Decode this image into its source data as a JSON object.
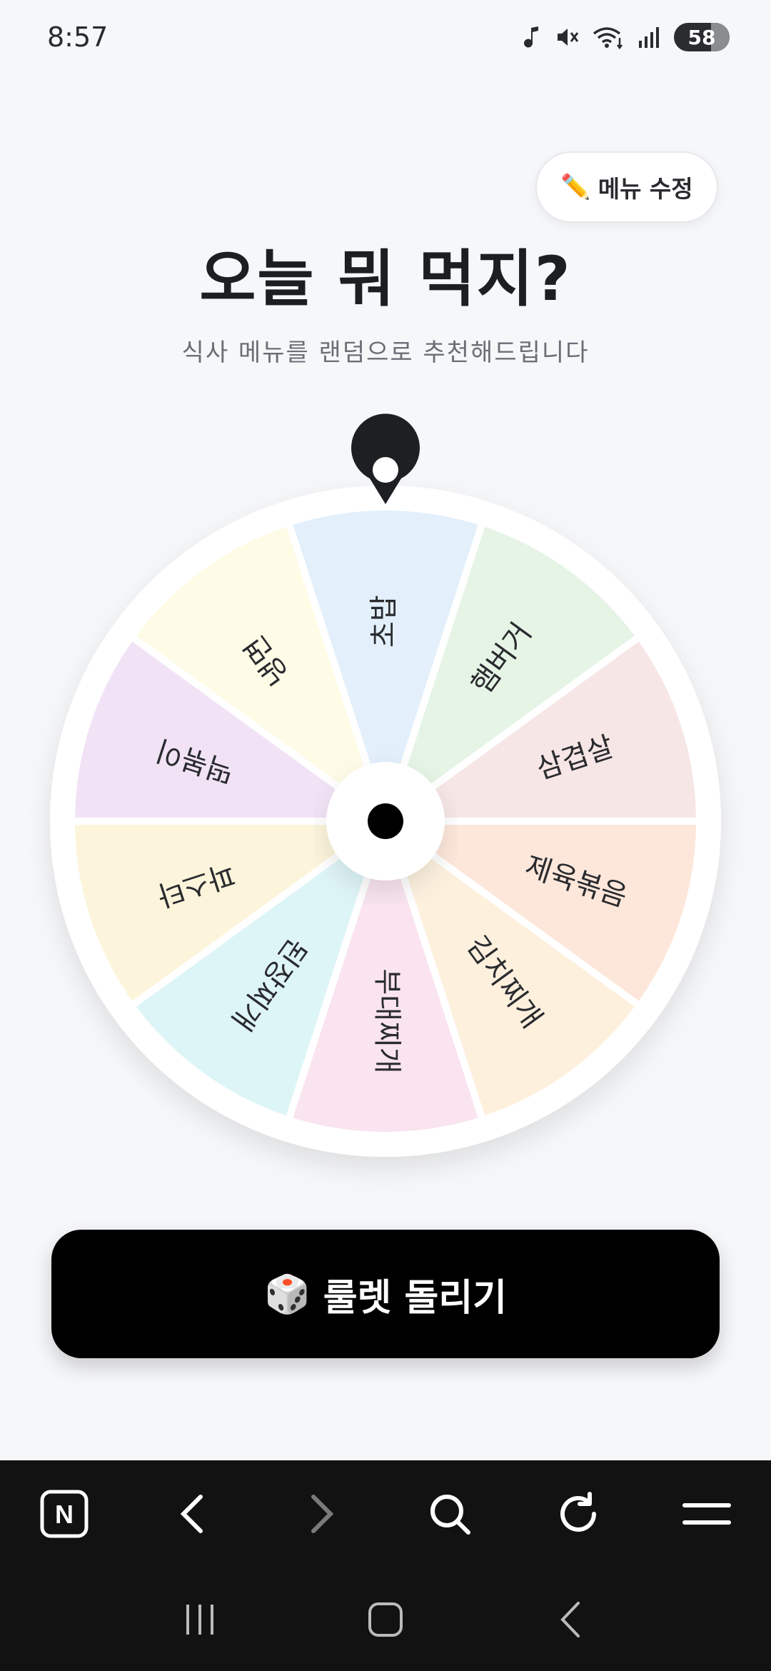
{
  "status_bar": {
    "time": "8:57",
    "battery": "58"
  },
  "header": {
    "edit_label": "메뉴 수정",
    "edit_icon": "✏️"
  },
  "main": {
    "title": "오늘 뭐 먹지?",
    "subtitle": "식사 메뉴를 랜덤으로 추천해드립니다"
  },
  "wheel": {
    "segments": [
      {
        "label": "초밥",
        "color": "#e3f0fb"
      },
      {
        "label": "햄버거",
        "color": "#e6f4e6"
      },
      {
        "label": "삼겹살",
        "color": "#f6e6e6"
      },
      {
        "label": "제육볶음",
        "color": "#fde7da"
      },
      {
        "label": "김치찌개",
        "color": "#fdf1de"
      },
      {
        "label": "부대찌개",
        "color": "#f9e4ef"
      },
      {
        "label": "된장찌개",
        "color": "#def5f7"
      },
      {
        "label": "파스타",
        "color": "#fcf5db"
      },
      {
        "label": "떡볶이",
        "color": "#f1e3f5"
      },
      {
        "label": "냉면",
        "color": "#fefbe6"
      }
    ]
  },
  "spin_button": {
    "icon": "🎲",
    "label": "룰렛 돌리기"
  },
  "browser_bar": {
    "items": [
      "naver-home",
      "back",
      "forward",
      "search",
      "refresh",
      "menu"
    ],
    "logo_letter": "N"
  }
}
